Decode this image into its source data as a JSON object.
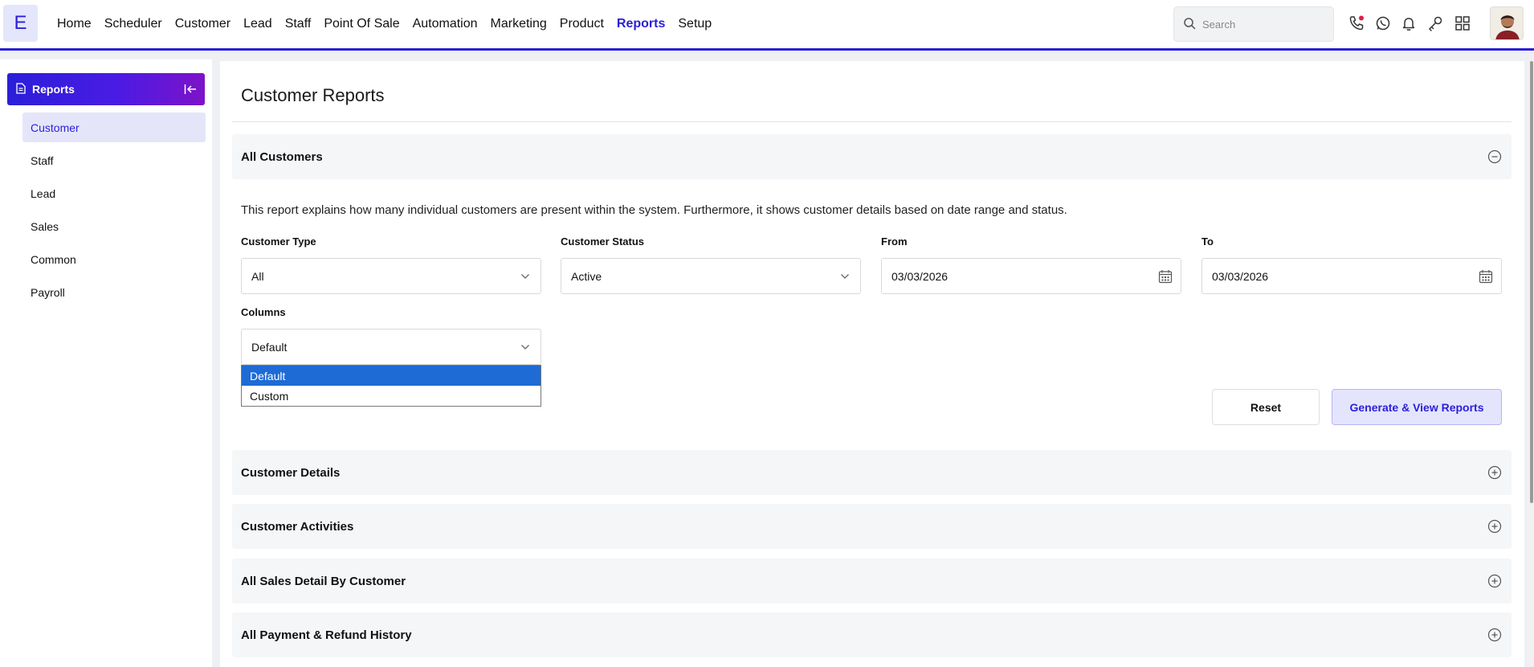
{
  "app": {
    "logo_letter": "E"
  },
  "nav": {
    "items": [
      {
        "label": "Home",
        "active": false
      },
      {
        "label": "Scheduler",
        "active": false
      },
      {
        "label": "Customer",
        "active": false
      },
      {
        "label": "Lead",
        "active": false
      },
      {
        "label": "Staff",
        "active": false
      },
      {
        "label": "Point Of Sale",
        "active": false
      },
      {
        "label": "Automation",
        "active": false
      },
      {
        "label": "Marketing",
        "active": false
      },
      {
        "label": "Product",
        "active": false
      },
      {
        "label": "Reports",
        "active": true
      },
      {
        "label": "Setup",
        "active": false
      }
    ],
    "accent_color": "#2a1fd9"
  },
  "search": {
    "placeholder": "Search"
  },
  "top_icons": [
    "phone-icon",
    "whatsapp-icon",
    "bell-icon",
    "key-icon",
    "apps-grid-icon"
  ],
  "sidebar": {
    "header": "Reports",
    "items": [
      {
        "label": "Customer",
        "active": true
      },
      {
        "label": "Staff",
        "active": false
      },
      {
        "label": "Lead",
        "active": false
      },
      {
        "label": "Sales",
        "active": false
      },
      {
        "label": "Common",
        "active": false
      },
      {
        "label": "Payroll",
        "active": false
      }
    ]
  },
  "main": {
    "title": "Customer Reports",
    "expanded_section": {
      "title": "All Customers",
      "description": "This report explains how many individual customers are present within the system. Furthermore, it shows customer details based on date range and status.",
      "fields": {
        "customer_type": {
          "label": "Customer Type",
          "value": "All"
        },
        "customer_status": {
          "label": "Customer Status",
          "value": "Active"
        },
        "from": {
          "label": "From",
          "value": "03/03/2026"
        },
        "to": {
          "label": "To",
          "value": "03/03/2026"
        },
        "columns": {
          "label": "Columns",
          "value": "Default",
          "options": [
            "Default",
            "Custom"
          ],
          "highlighted": "Default"
        }
      },
      "buttons": {
        "reset": "Reset",
        "generate": "Generate & View Reports"
      }
    },
    "collapsed_sections": [
      {
        "title": "Customer Details"
      },
      {
        "title": "Customer Activities"
      },
      {
        "title": "All Sales Detail By Customer"
      },
      {
        "title": "All Payment & Refund History"
      }
    ]
  }
}
